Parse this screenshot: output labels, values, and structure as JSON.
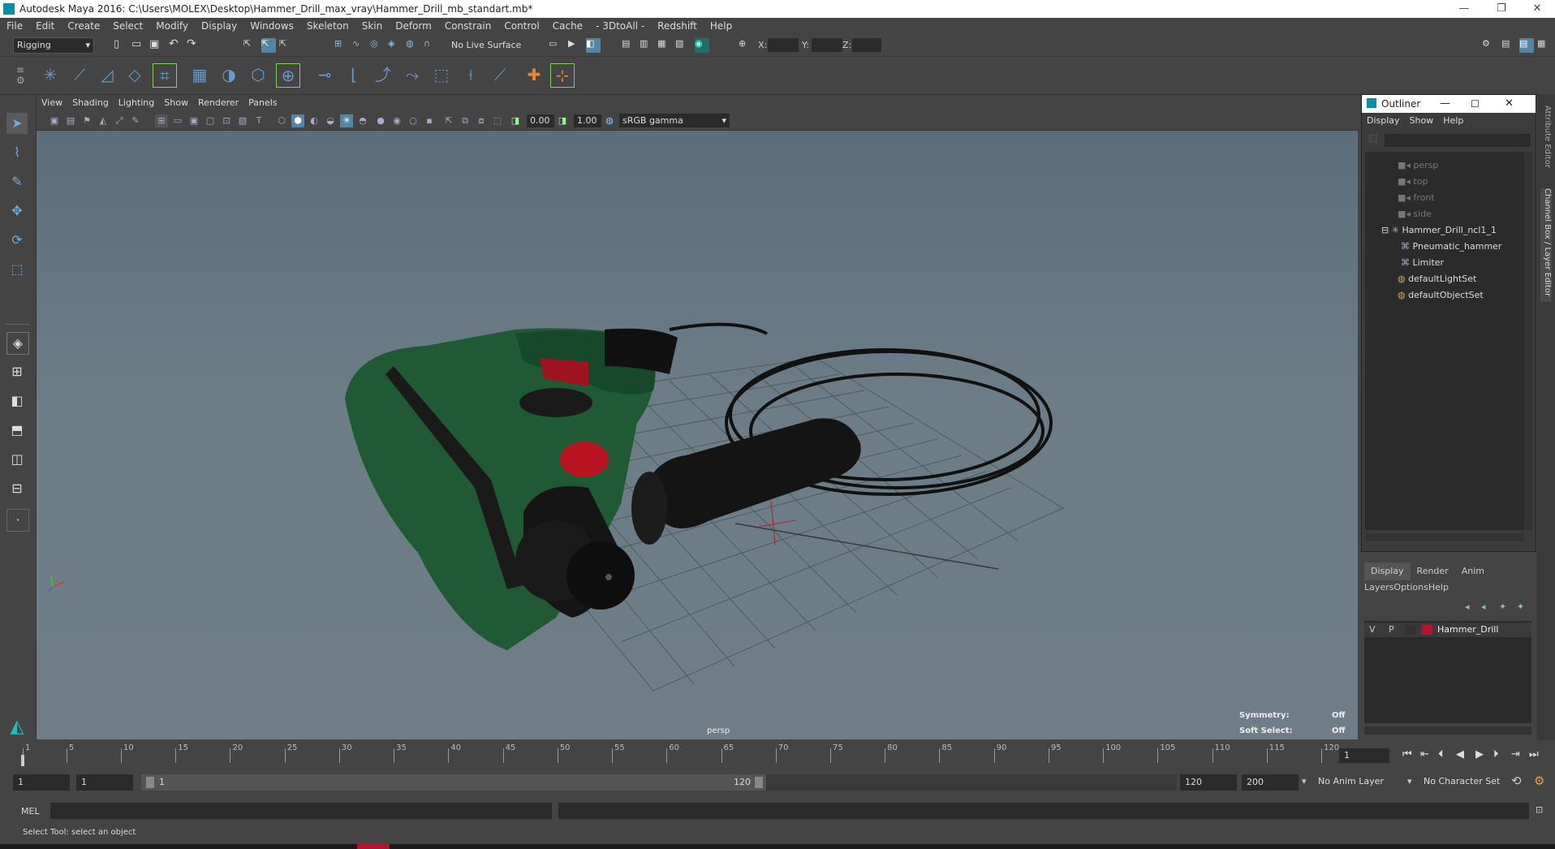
{
  "window": {
    "title": "Autodesk Maya 2016: C:\\Users\\MOLEX\\Desktop\\Hammer_Drill_max_vray\\Hammer_Drill_mb_standart.mb*",
    "minimize": "—",
    "restore": "❐",
    "close": "✕"
  },
  "menubar": [
    "File",
    "Edit",
    "Create",
    "Select",
    "Modify",
    "Display",
    "Windows",
    "Skeleton",
    "Skin",
    "Deform",
    "Constrain",
    "Control",
    "Cache",
    "- 3DtoAll -",
    "Redshift",
    "Help"
  ],
  "statusline": {
    "mode": "Rigging",
    "live_surface": "No Live Surface",
    "x_label": "X:",
    "y_label": "Y:",
    "z_label": "Z:"
  },
  "panel_menu": [
    "View",
    "Shading",
    "Lighting",
    "Show",
    "Renderer",
    "Panels"
  ],
  "panel_tools": {
    "exposure": "0.00",
    "gamma": "1.00",
    "color_space": "sRGB gamma"
  },
  "viewport": {
    "camera_label": "persp",
    "symmetry_label": "Symmetry:",
    "symmetry_value": "Off",
    "soft_select_label": "Soft Select:",
    "soft_select_value": "Off"
  },
  "outliner": {
    "title": "Outliner",
    "menu": [
      "Display",
      "Show",
      "Help"
    ],
    "items": [
      "persp",
      "top",
      "front",
      "side",
      "Hammer_Drill_ncl1_1",
      "Pneumatic_hammer",
      "Limiter",
      "defaultLightSet",
      "defaultObjectSet"
    ]
  },
  "layers": {
    "tabs": [
      "Display",
      "Render",
      "Anim"
    ],
    "menu": [
      "Layers",
      "Options",
      "Help"
    ],
    "layer": {
      "v": "V",
      "p": "P",
      "name": "Hammer_Drill",
      "color": "#b0142e"
    }
  },
  "timeline": {
    "ticks": [
      "1",
      "5",
      "10",
      "15",
      "20",
      "25",
      "30",
      "35",
      "40",
      "45",
      "50",
      "55",
      "60",
      "65",
      "70",
      "75",
      "80",
      "85",
      "90",
      "95",
      "100",
      "105",
      "110",
      "115",
      "120"
    ],
    "current_frame": "1"
  },
  "range": {
    "start": "1",
    "playback_start": "1",
    "slider_start": "1",
    "slider_end": "120",
    "playback_end": "120",
    "end": "200",
    "anim_layer": "No Anim Layer",
    "char_set": "No Character Set"
  },
  "command": {
    "lang": "MEL"
  },
  "help_line": "Select Tool: select an object",
  "side_tabs": {
    "attribute_editor": "Attribute Editor",
    "channel_box": "Channel Box / Layer Editor"
  }
}
